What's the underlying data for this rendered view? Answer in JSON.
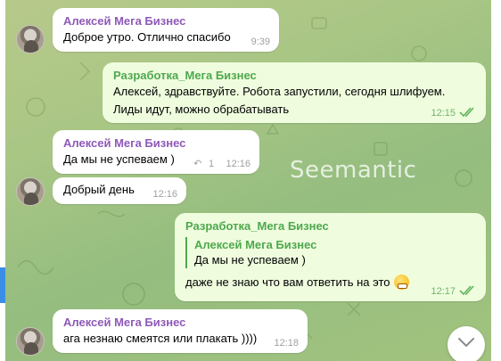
{
  "watermark": "Seemantic",
  "messages": [
    {
      "sender": "Алексей Мега Бизнес",
      "text": "Доброе утро. Отлично спасибо",
      "time": "9:39"
    },
    {
      "sender": "Разработка_Мега Бизнес",
      "line1": "Алексей, здравствуйте. Робота запустили, сегодня шлифуем.",
      "line2": "Лиды идут, можно обрабатывать",
      "time": "12:15"
    },
    {
      "sender": "Алексей Мега Бизнес",
      "text": "Да мы не успеваем )",
      "reply_count": "1",
      "time": "12:16"
    },
    {
      "text": "Добрый день",
      "time": "12:16"
    },
    {
      "sender": "Разработка_Мега Бизнес",
      "quote_sender": "Алексей Мега Бизнес",
      "quote_text": "Да мы не успеваем )",
      "text": "даже не знаю что вам ответить на это",
      "time": "12:17"
    },
    {
      "sender": "Алексей Мега Бизнес",
      "text": "ага незнаю смеятся или плакать ))))",
      "time": "12:18"
    }
  ],
  "icons": {
    "read_receipt": "double-check-icon",
    "reply": "reply-arrow-icon",
    "scroll": "chevron-down-icon",
    "emoji": "grimacing-emoji-icon"
  },
  "colors": {
    "incoming_bubble": "#ffffff",
    "outgoing_bubble": "#effdde",
    "sender_in": "#8e59b8",
    "sender_out": "#4ea84e"
  }
}
